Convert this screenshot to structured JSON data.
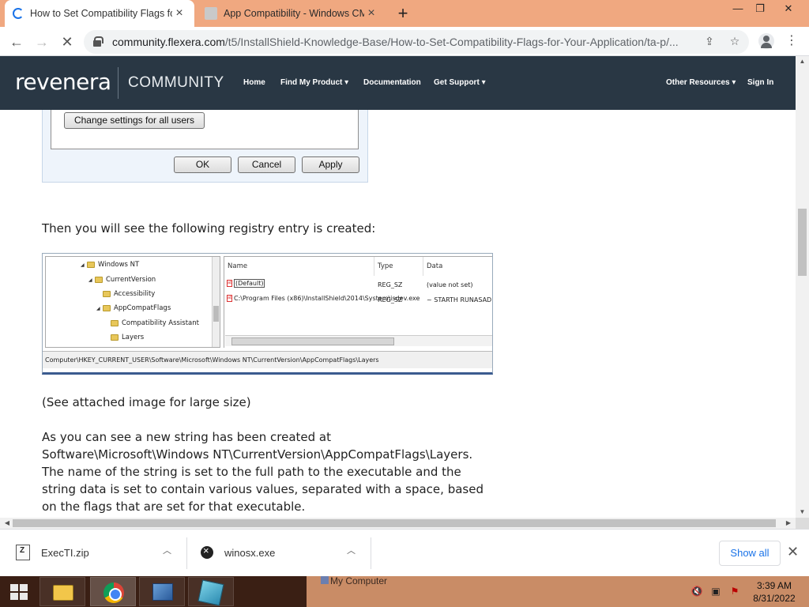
{
  "browser": {
    "tabs": [
      {
        "title": "How to Set Compatibility Flags fo",
        "active": true,
        "loading": true
      },
      {
        "title": "App Compatibility - Windows CM",
        "active": false
      }
    ],
    "new_tab_label": "+",
    "window_controls": {
      "minimize": "—",
      "restore": "❐",
      "close": "✕"
    },
    "url_host": "community.flexera.com",
    "url_path": "/t5/InstallShield-Knowledge-Base/How-to-Set-Compatibility-Flags-for-Your-Application/ta-p/..."
  },
  "site_nav": {
    "logo": "revenera",
    "section": "COMMUNITY",
    "links": [
      "Home",
      "Find My Product",
      "Documentation",
      "Get Support"
    ],
    "right_links": [
      "Other Resources",
      "Sign In"
    ],
    "dropdown_marker": "▾"
  },
  "dialog": {
    "change_all_users": "Change settings for all users",
    "ok": "OK",
    "cancel": "Cancel",
    "apply": "Apply"
  },
  "article": {
    "p1": "Then you will see the following registry entry is created:",
    "p2": "(See attached image for large size)",
    "p3": "As you can see a new string has been created at Software\\Microsoft\\Windows NT\\CurrentVersion\\AppCompatFlags\\Layers. The name of the string is set to the full path to the executable and the string data is set to contain various values, separated with a space, based on the flags that are set for that executable."
  },
  "registry": {
    "tree": [
      "Windows NT",
      "CurrentVersion",
      "Accessibility",
      "AppCompatFlags",
      "Compatibility Assistant",
      "Layers"
    ],
    "columns": {
      "name": "Name",
      "type": "Type",
      "data": "Data"
    },
    "rows": [
      {
        "name": "(Default)",
        "type": "REG_SZ",
        "data": "(value not set)"
      },
      {
        "name": "C:\\Program Files (x86)\\InstallShield\\2014\\System\\isdev.exe",
        "type": "REG_SZ",
        "data": "~ STARTH RUNASADMIN"
      }
    ],
    "status_path": "Computer\\HKEY_CURRENT_USER\\Software\\Microsoft\\Windows NT\\CurrentVersion\\AppCompatFlags\\Layers"
  },
  "downloads": {
    "items": [
      {
        "name": "ExecTI.zip"
      },
      {
        "name": "winosx.exe"
      }
    ],
    "show_all": "Show all"
  },
  "taskbar": {
    "my_computer": "My Computer",
    "time": "3:39 AM",
    "date": "8/31/2022"
  }
}
